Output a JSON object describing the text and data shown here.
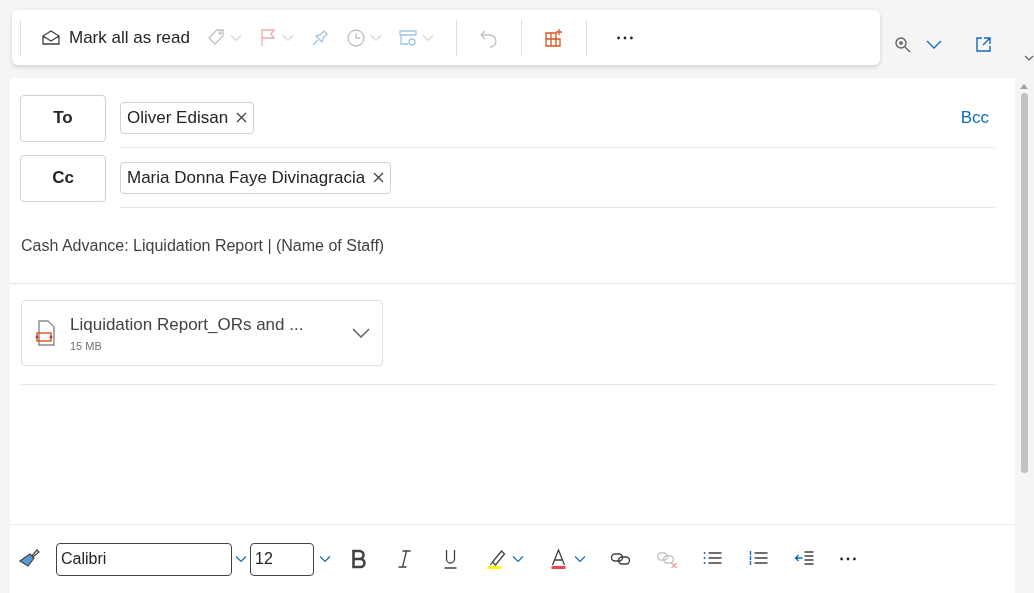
{
  "toolbar": {
    "groups": [
      [
        {
          "kind": "mark-read",
          "label": "Mark all as read",
          "disabled": false,
          "has_menu": false
        },
        {
          "kind": "tag",
          "disabled": true,
          "has_menu": true
        },
        {
          "kind": "flag",
          "disabled": true,
          "has_menu": true
        },
        {
          "kind": "pin",
          "disabled": true,
          "has_menu": false
        },
        {
          "kind": "clock",
          "disabled": true,
          "has_menu": true
        },
        {
          "kind": "rules",
          "disabled": true,
          "has_menu": true
        }
      ],
      [
        {
          "kind": "undo",
          "disabled": true,
          "has_menu": false
        }
      ],
      [
        {
          "kind": "table",
          "disabled": false,
          "has_menu": false
        }
      ],
      [
        {
          "kind": "more",
          "disabled": false,
          "has_menu": false
        }
      ]
    ]
  },
  "recipients": [
    {
      "button": "To",
      "chips": [
        "Oliver Edisan"
      ],
      "extra": "Bcc"
    },
    {
      "button": "Cc",
      "chips": [
        "Maria Donna Faye Divinagracia"
      ]
    }
  ],
  "subject": {
    "value": "Cash Advance: Liquidation Report | (Name of Staff)"
  },
  "attachments": [
    {
      "name": "Liquidation Report_ORs and ...",
      "size": "15 MB"
    }
  ],
  "format_bar": {
    "font": "Calibri",
    "size": "12",
    "tools": [
      {
        "kind": "bold",
        "disabled": false
      },
      {
        "kind": "italic",
        "disabled": false
      },
      {
        "kind": "underline",
        "disabled": false
      },
      {
        "kind": "highlight",
        "disabled": false
      },
      {
        "kind": "font-color",
        "disabled": false
      },
      {
        "kind": "link",
        "disabled": false
      },
      {
        "kind": "unlink",
        "disabled": true
      },
      {
        "kind": "bullets",
        "disabled": false
      },
      {
        "kind": "numbering",
        "disabled": false
      },
      {
        "kind": "outdent",
        "disabled": false
      },
      {
        "kind": "more",
        "disabled": false
      }
    ]
  }
}
